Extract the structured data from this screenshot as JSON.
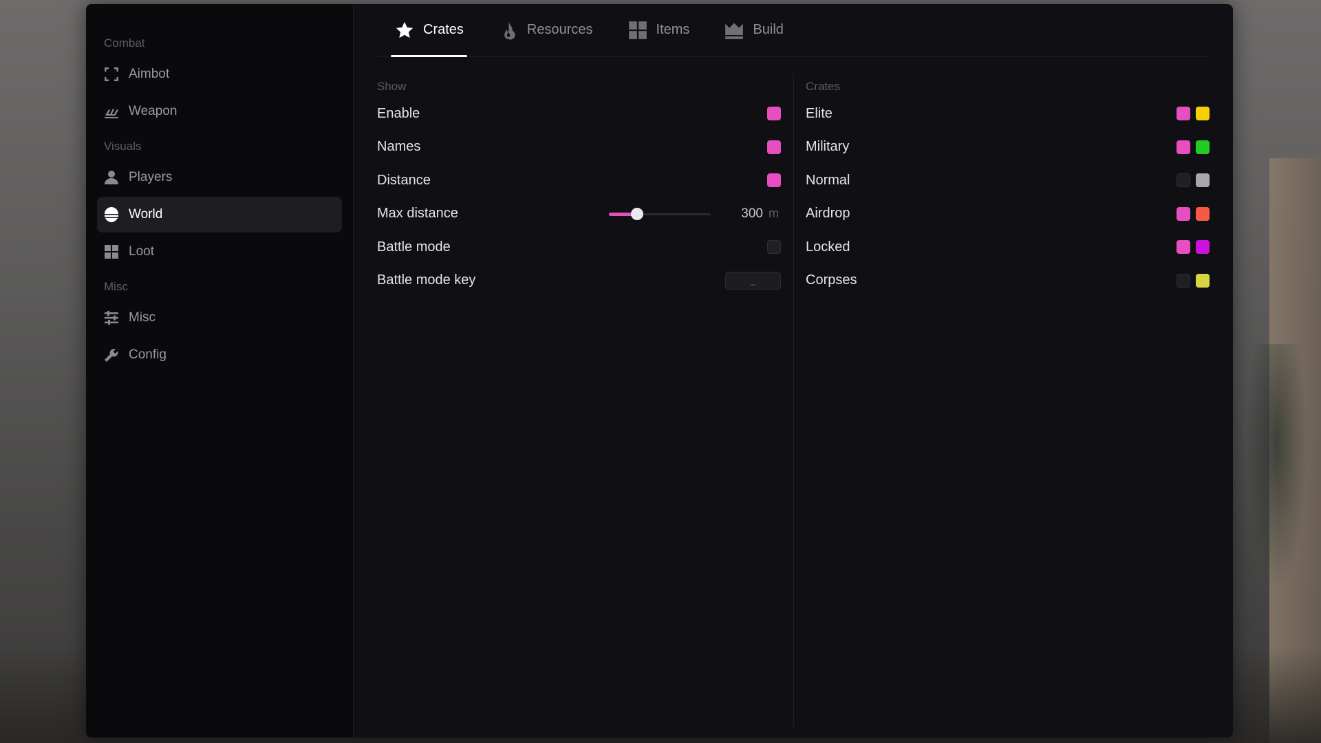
{
  "colors": {
    "accent": "#e74fc1",
    "window_bg": "#101014",
    "sidebar_bg": "#0a0a0c",
    "active_item_bg": "#1d1d22",
    "swatch_off": "#1f1f24"
  },
  "sidebar": {
    "sections": [
      {
        "label": "Combat",
        "items": [
          {
            "label": "Aimbot",
            "icon": "crosshair-frame-icon",
            "active": false
          },
          {
            "label": "Weapon",
            "icon": "weapon-icon",
            "active": false
          }
        ]
      },
      {
        "label": "Visuals",
        "items": [
          {
            "label": "Players",
            "icon": "user-icon",
            "active": false
          },
          {
            "label": "World",
            "icon": "globe-icon",
            "active": true
          },
          {
            "label": "Loot",
            "icon": "grid-icon",
            "active": false
          }
        ]
      },
      {
        "label": "Misc",
        "items": [
          {
            "label": "Misc",
            "icon": "sliders-icon",
            "active": false
          },
          {
            "label": "Config",
            "icon": "wrench-icon",
            "active": false
          }
        ]
      }
    ]
  },
  "tabs": [
    {
      "label": "Crates",
      "icon": "star-icon",
      "active": true
    },
    {
      "label": "Resources",
      "icon": "flame-icon",
      "active": false
    },
    {
      "label": "Items",
      "icon": "grid-icon",
      "active": false
    },
    {
      "label": "Build",
      "icon": "crown-icon",
      "active": false
    }
  ],
  "show": {
    "label": "Show",
    "enable": {
      "label": "Enable",
      "checked": true,
      "color": "#e74fc1"
    },
    "names": {
      "label": "Names",
      "checked": true,
      "color": "#e74fc1"
    },
    "distance": {
      "label": "Distance",
      "checked": true,
      "color": "#e74fc1"
    },
    "max_distance": {
      "label": "Max distance",
      "value": "300",
      "unit": "m",
      "fraction": 0.28
    },
    "battle_mode": {
      "label": "Battle mode",
      "checked": false
    },
    "battle_mode_key": {
      "label": "Battle mode key",
      "value": "_"
    }
  },
  "crates": {
    "label": "Crates",
    "items": [
      {
        "label": "Elite",
        "checked": true,
        "color": "#f5d000"
      },
      {
        "label": "Military",
        "checked": true,
        "color": "#22cc22"
      },
      {
        "label": "Normal",
        "checked": false,
        "color": "#a8a8a8"
      },
      {
        "label": "Airdrop",
        "checked": true,
        "color": "#f45a46"
      },
      {
        "label": "Locked",
        "checked": true,
        "color": "#cc11dd"
      },
      {
        "label": "Corpses",
        "checked": false,
        "color": "#d8d640"
      }
    ]
  }
}
